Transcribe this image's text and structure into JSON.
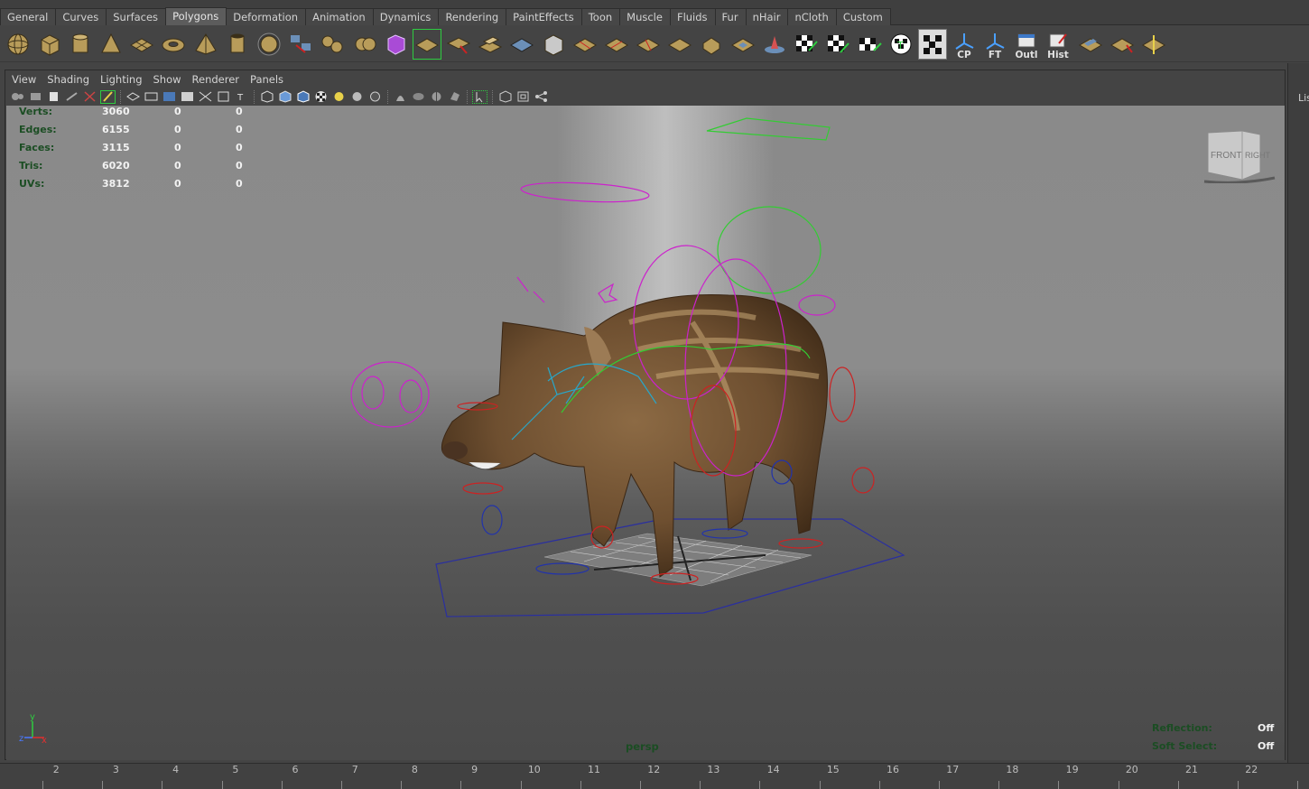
{
  "shelf": {
    "tabs": [
      "General",
      "Curves",
      "Surfaces",
      "Polygons",
      "Deformation",
      "Animation",
      "Dynamics",
      "Rendering",
      "PaintEffects",
      "Toon",
      "Muscle",
      "Fluids",
      "Fur",
      "nHair",
      "nCloth",
      "Custom"
    ],
    "active_tab": "Polygons",
    "text_buttons": {
      "cp": "CP",
      "ft": "FT",
      "outl": "Outl",
      "hist": "Hist"
    }
  },
  "panel": {
    "menus": [
      "View",
      "Shading",
      "Lighting",
      "Show",
      "Renderer",
      "Panels"
    ]
  },
  "hud": {
    "stats": [
      {
        "label": "Verts:",
        "v1": "3060",
        "v2": "0",
        "v3": "0"
      },
      {
        "label": "Edges:",
        "v1": "6155",
        "v2": "0",
        "v3": "0"
      },
      {
        "label": "Faces:",
        "v1": "3115",
        "v2": "0",
        "v3": "0"
      },
      {
        "label": "Tris:",
        "v1": "6020",
        "v2": "0",
        "v3": "0"
      },
      {
        "label": "UVs:",
        "v1": "3812",
        "v2": "0",
        "v3": "0"
      }
    ],
    "camera": "persp",
    "reflection_label": "Reflection:",
    "reflection_value": "Off",
    "soft_select_label": "Soft Select:",
    "soft_select_value": "Off",
    "view_cube": {
      "front": "FRONT",
      "right": "RIGHT"
    },
    "axis": {
      "x": "x",
      "y": "y",
      "z": "z"
    }
  },
  "right_strip": {
    "label": "Lis"
  },
  "timeline": {
    "numbers": [
      "2",
      "3",
      "4",
      "5",
      "6",
      "7",
      "8",
      "9",
      "10",
      "11",
      "12",
      "13",
      "14",
      "15",
      "16",
      "17",
      "18",
      "19",
      "20",
      "21",
      "22"
    ]
  },
  "colors": {
    "hud_label": "#1b4d23",
    "rig_magenta": "#cc22cc",
    "rig_green": "#33cc33",
    "rig_red": "#cc2222",
    "rig_blue": "#2233aa"
  }
}
